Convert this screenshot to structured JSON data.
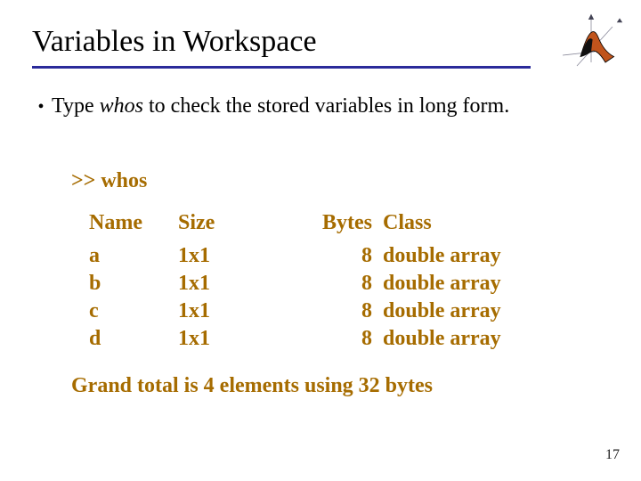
{
  "title": "Variables in Workspace",
  "bullet": {
    "before": "Type ",
    "command": "whos",
    "after": " to check the stored variables in long form."
  },
  "code": {
    "prompt": ">> whos",
    "headers": {
      "name": "Name",
      "size": "Size",
      "bytes": "Bytes",
      "class": "Class"
    },
    "rows": [
      {
        "name": "a",
        "size": "1x1",
        "bytes": "8",
        "class": "double array"
      },
      {
        "name": "b",
        "size": "1x1",
        "bytes": "8",
        "class": "double array"
      },
      {
        "name": "c",
        "size": "1x1",
        "bytes": "8",
        "class": "double array"
      },
      {
        "name": "d",
        "size": "1x1",
        "bytes": "8",
        "class": "double array"
      }
    ],
    "grand_total": "Grand total is 4 elements using 32 bytes"
  },
  "page_number": "17"
}
